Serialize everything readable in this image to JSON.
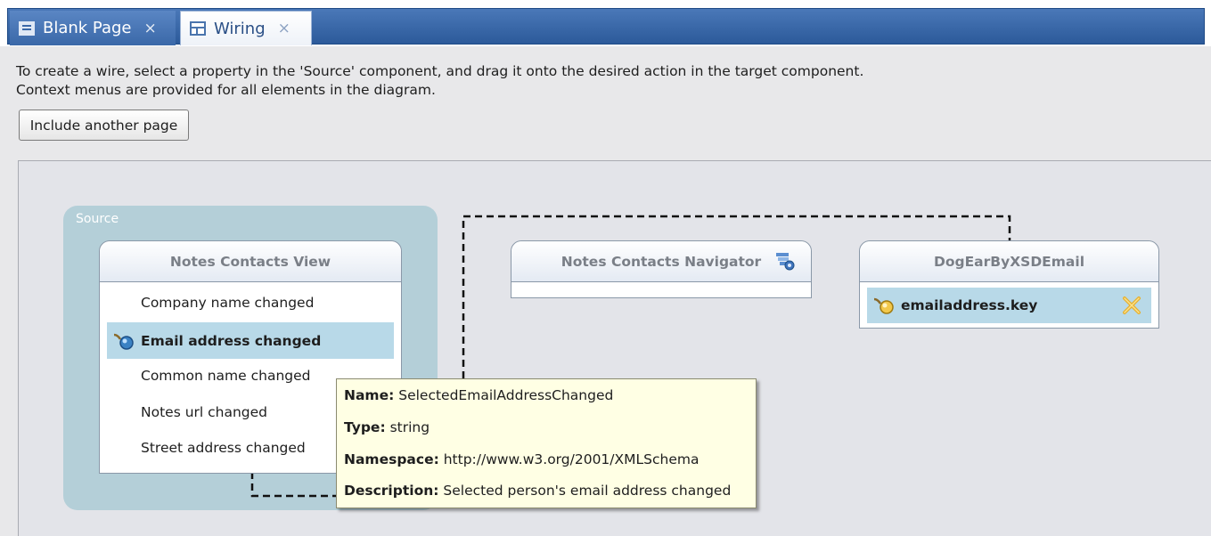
{
  "tabs": [
    {
      "label": "Blank Page",
      "close": "×",
      "icon": "page-icon",
      "active": false
    },
    {
      "label": "Wiring",
      "close": "×",
      "icon": "table-icon",
      "active": true
    }
  ],
  "instructions": {
    "line1": "To create a wire, select a property in the 'Source' component, and drag it onto the desired action in the target component.",
    "line2": "Context menus are provided for all elements in the diagram."
  },
  "include_button_label": "Include another page",
  "source_group_label": "Source",
  "components": {
    "view": {
      "title": "Notes Contacts View",
      "items": [
        "Company name changed",
        "Email address changed",
        "Common name changed",
        "Notes url changed",
        "Street address changed"
      ],
      "selected_index": 1,
      "selected_icon": "plug-icon"
    },
    "navigator": {
      "title": "Notes Contacts Navigator",
      "icon": "component-settings-icon"
    },
    "target": {
      "title": "DogEarByXSDEmail",
      "item": "emailaddress.key",
      "item_icon": "plug-icon",
      "remove_icon": "remove-wire-icon"
    }
  },
  "tooltip": {
    "name_label": "Name:",
    "name_value": "SelectedEmailAddressChanged",
    "type_label": "Type:",
    "type_value": "string",
    "namespace_label": "Namespace:",
    "namespace_value": "http://www.w3.org/2001/XMLSchema",
    "description_label": "Description:",
    "description_value": "Selected person's email address changed"
  },
  "colors": {
    "tab_bar": "#2c5a9a",
    "source_group": "#b4cfd8",
    "selection": "#b8d9e8",
    "tooltip_bg": "#ffffe4",
    "canvas": "#e3e4e9"
  }
}
